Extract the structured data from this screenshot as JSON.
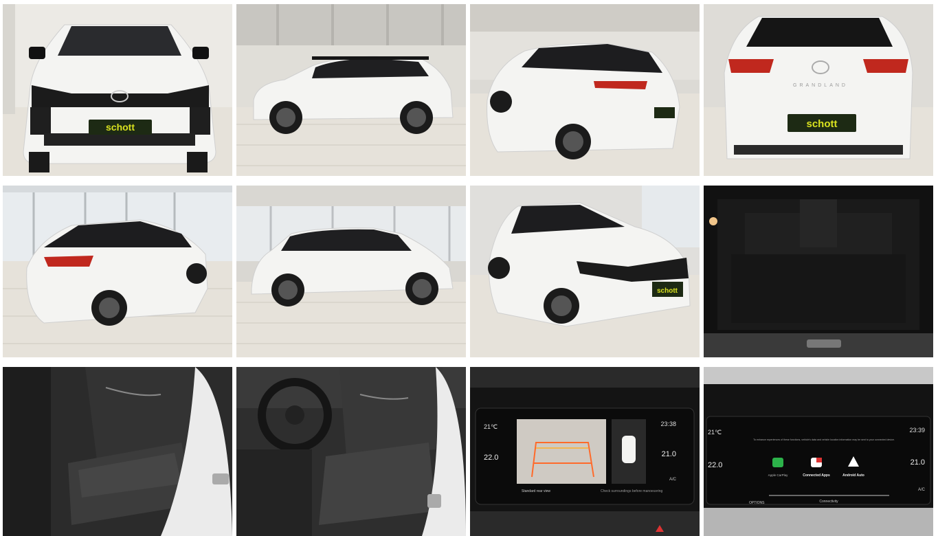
{
  "gallery": {
    "photos": [
      {
        "view": "front",
        "plate": "schott"
      },
      {
        "view": "side-right"
      },
      {
        "view": "rear-three-quarter-right",
        "plate": "schott"
      },
      {
        "view": "rear",
        "plate": "schott",
        "badge": "GRANDLAND"
      },
      {
        "view": "rear-three-quarter-left"
      },
      {
        "view": "side-left"
      },
      {
        "view": "front-three-quarter",
        "plate": "schott"
      },
      {
        "view": "trunk"
      },
      {
        "view": "rear-seats"
      },
      {
        "view": "driver-seat"
      },
      {
        "view": "infotainment-camera",
        "left_top": "21℃",
        "right_top": "23:38",
        "left_temp": "22.0",
        "right_temp": "21.0",
        "ac": "A/C",
        "footer_left": "Standard rear view",
        "footer_right": "Check surroundings before manoeuvring"
      },
      {
        "view": "infotainment-connectivity",
        "left_top": "21℃",
        "right_top": "23:39",
        "left_temp": "22.0",
        "right_temp": "21.0",
        "ac": "A/C",
        "notice": "To enhance experiences of these functions, vehicle's data and vehicle location information may be sent to your connected device.",
        "apps": [
          "Apple CarPlay",
          "Connected Apps",
          "Android Auto"
        ],
        "footer_left": "OPTIONS",
        "footer_center": "Connectivity"
      }
    ]
  },
  "colors": {
    "car_white": "#f4f4f2",
    "roof_black": "#151515",
    "plate_green": "#1d2a14",
    "plate_yellow": "#d9e21f",
    "floor_tile": "#e8e4dc",
    "taillight_red": "#c0281e"
  }
}
